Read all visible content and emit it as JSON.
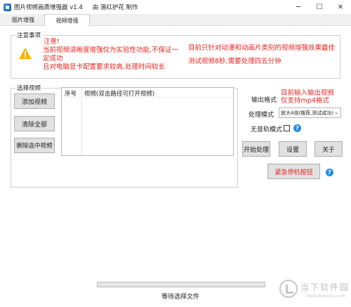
{
  "window": {
    "title": "图片视频画质增强器 v1.4",
    "author": "由 落红护花 制作",
    "minimize": "─",
    "maximize": "☐",
    "close": "✕"
  },
  "tabs": [
    {
      "label": "图片增强",
      "active": false
    },
    {
      "label": "视频增强",
      "active": true
    }
  ],
  "notice": {
    "group_title": "注意事项",
    "icon": "warning-icon",
    "heading": "注意!",
    "line1": "当前视频请晰度增强仅为实验性功能,不保证一定成功",
    "line2": "且对电脑显卡配置要求较高,处理时间较长",
    "right_line1": "目前只针对动漫和动画片类别的视频增强效果最佳",
    "right_line2": "测试视频8秒,需要处理四五分钟"
  },
  "select_video": {
    "group_title": "选择视频",
    "add_button": "添加视频",
    "clear_button": "清除全部",
    "delete_button": "删除选中视频",
    "list_columns": [
      "序号",
      "视频(双击路径可打开视频)"
    ]
  },
  "settings": {
    "output_format_label": "输出格式",
    "output_format_note1": "目前输入输出视频",
    "output_format_note2": "仅支持mp4格式",
    "process_mode_label": "处理模式",
    "process_mode_value": "放大4倍(推荐,测试成功)",
    "silent_track_label": "无音轨模式",
    "silent_track_checked": false
  },
  "actions": {
    "start": "开始处理",
    "settings": "设置",
    "about": "关于",
    "emergency_stop": "紧急停机按钮"
  },
  "status": {
    "progress": 0,
    "text": "等待选择文件"
  },
  "watermark": {
    "text": "当下软件园",
    "url": "www.downxia.com"
  },
  "colors": {
    "notice_red": "#e8271f",
    "help_blue": "#1f8ee6",
    "warning_yellow": "#f5b400"
  }
}
